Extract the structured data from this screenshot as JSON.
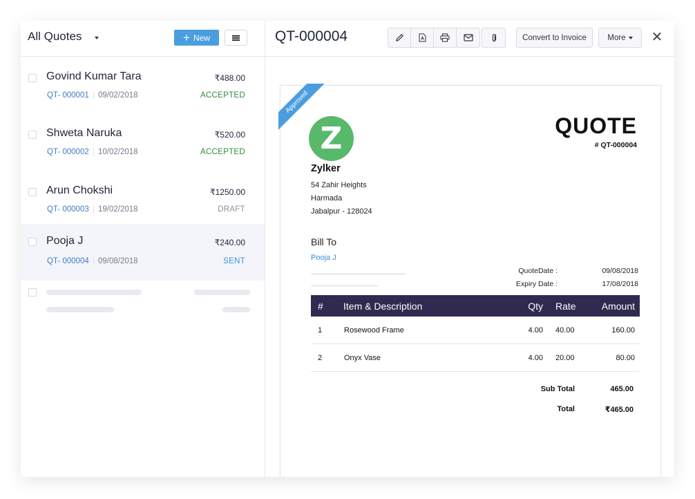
{
  "list": {
    "title": "All Quotes",
    "new_label": "New",
    "items": [
      {
        "name": "Govind Kumar Tara",
        "amount": "₹488.00",
        "id": "QT- 000001",
        "date": "09/02/2018",
        "status": "ACCEPTED"
      },
      {
        "name": "Shweta Naruka",
        "amount": "₹520.00",
        "id": "QT- 000002",
        "date": "10/02/2018",
        "status": "ACCEPTED"
      },
      {
        "name": "Arun Chokshi",
        "amount": "₹1250.00",
        "id": "QT- 000003",
        "date": "19/02/2018",
        "status": "DRAFT"
      },
      {
        "name": "Pooja J",
        "amount": "₹240.00",
        "id": "QT- 000004",
        "date": "09/08/2018",
        "status": "SENT"
      }
    ]
  },
  "detail": {
    "title": "QT-000004",
    "toolbar": {
      "icons": [
        "pencil-icon",
        "pdf-icon",
        "printer-icon",
        "mail-icon",
        "paperclip-icon"
      ],
      "convert_label": "Convert to Invoice",
      "more_label": "More",
      "close_label": "✕"
    }
  },
  "document": {
    "ribbon": "Approved",
    "logo_letter": "Z",
    "org": {
      "name": "Zylker",
      "address": [
        "54 Zahir Heights",
        "Harmada",
        "Jabalpur - 128024"
      ]
    },
    "heading": "QUOTE",
    "number": "# QT-000004",
    "bill_to_label": "Bill To",
    "bill_to_name": "Pooja J",
    "quote_date_label": "QuoteDate :",
    "quote_date": "09/08/2018",
    "expiry_date_label": "Expiry Date :",
    "expiry_date": "17/08/2018",
    "table": {
      "headers": {
        "num": "#",
        "item": "Item & Description",
        "qty": "Qty",
        "rate": "Rate",
        "amount": "Amount"
      },
      "rows": [
        {
          "num": "1",
          "item": "Rosewood Frame",
          "qty": "4.00",
          "rate": "40.00",
          "amount": "160.00"
        },
        {
          "num": "2",
          "item": "Onyx Vase",
          "qty": "4.00",
          "rate": "20.00",
          "amount": "80.00"
        }
      ]
    },
    "sub_total_label": "Sub Total",
    "sub_total": "465.00",
    "total_label": "Total",
    "total": "₹465.00"
  },
  "colors": {
    "accent": "#4a9ee0",
    "accepted": "#2e8b3e",
    "draft": "#8d909b",
    "sent": "#3a8fdc",
    "table_header": "#2f2a4f",
    "logo": "#58b96b"
  }
}
